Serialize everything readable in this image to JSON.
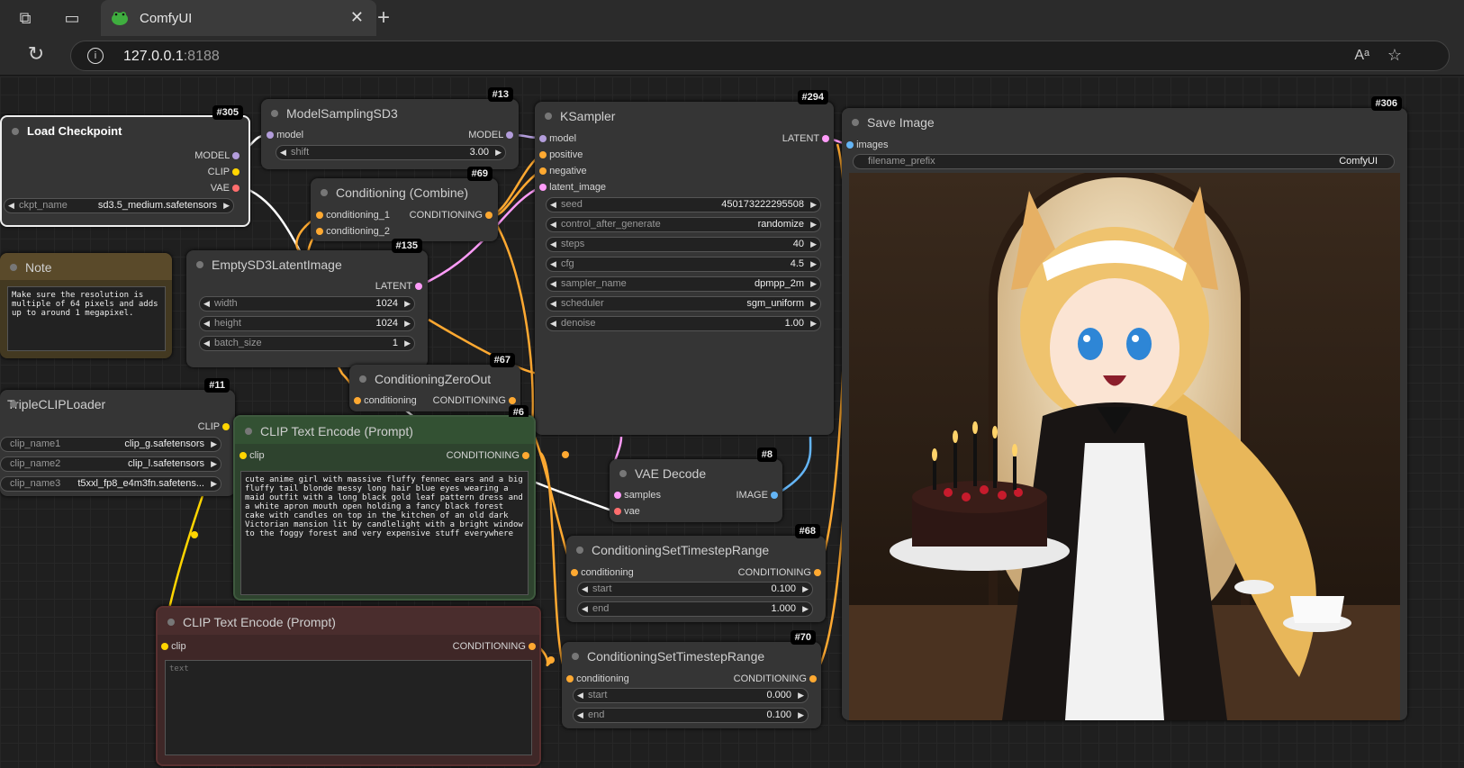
{
  "browser": {
    "tab_title": "ComfyUI",
    "url_host": "127.0.0.1",
    "url_port": ":8188"
  },
  "nodes": {
    "load_checkpoint": {
      "id": "#305",
      "title": "Load Checkpoint",
      "outputs": [
        "MODEL",
        "CLIP",
        "VAE"
      ],
      "widget": {
        "label": "ckpt_name",
        "value": "sd3.5_medium.safetensors"
      }
    },
    "model_sampling": {
      "id": "#13",
      "title": "ModelSamplingSD3",
      "input": "model",
      "output": "MODEL",
      "widget": {
        "label": "shift",
        "value": "3.00"
      }
    },
    "cond_combine": {
      "id": "#69",
      "title": "Conditioning (Combine)",
      "inputs": [
        "conditioning_1",
        "conditioning_2"
      ],
      "output": "CONDITIONING"
    },
    "note": {
      "title": "Note",
      "text": "Make sure the resolution is multiple of 64 pixels and adds up to around 1 megapixel."
    },
    "empty_latent": {
      "id": "#135",
      "title": "EmptySD3LatentImage",
      "output": "LATENT",
      "widgets": [
        {
          "label": "width",
          "value": "1024"
        },
        {
          "label": "height",
          "value": "1024"
        },
        {
          "label": "batch_size",
          "value": "1"
        }
      ]
    },
    "ksampler": {
      "id": "#294",
      "title": "KSampler",
      "inputs": [
        "model",
        "positive",
        "negative",
        "latent_image"
      ],
      "output": "LATENT",
      "widgets": [
        {
          "label": "seed",
          "value": "450173222295508"
        },
        {
          "label": "control_after_generate",
          "value": "randomize"
        },
        {
          "label": "steps",
          "value": "40"
        },
        {
          "label": "cfg",
          "value": "4.5"
        },
        {
          "label": "sampler_name",
          "value": "dpmpp_2m"
        },
        {
          "label": "scheduler",
          "value": "sgm_uniform"
        },
        {
          "label": "denoise",
          "value": "1.00"
        }
      ]
    },
    "cond_zero": {
      "id": "#67",
      "title": "ConditioningZeroOut",
      "input": "conditioning",
      "output": "CONDITIONING"
    },
    "triple_clip": {
      "id": "#11",
      "title": "TripleCLIPLoader",
      "output": "CLIP",
      "widgets": [
        {
          "label": "clip_name1",
          "value": "clip_g.safetensors"
        },
        {
          "label": "clip_name2",
          "value": "clip_l.safetensors"
        },
        {
          "label": "clip_name3",
          "value": "t5xxl_fp8_e4m3fn.safetens..."
        }
      ]
    },
    "clip_pos": {
      "id": "#6",
      "title": "CLIP Text Encode (Prompt)",
      "input": "clip",
      "output": "CONDITIONING",
      "text": "cute anime girl with massive fluffy fennec ears and a big fluffy tail blonde messy long hair blue eyes wearing a maid outfit with a long black gold leaf pattern dress and a white apron mouth open holding a fancy black forest cake with candles on top in the kitchen of an old dark Victorian mansion lit by candlelight with a bright window to the foggy forest and very expensive stuff everywhere"
    },
    "clip_neg": {
      "title": "CLIP Text Encode (Prompt)",
      "input": "clip",
      "output": "CONDITIONING",
      "placeholder": "text"
    },
    "vae_decode": {
      "id": "#8",
      "title": "VAE Decode",
      "inputs": [
        "samples",
        "vae"
      ],
      "output": "IMAGE"
    },
    "ts_range_a": {
      "id": "#68",
      "title": "ConditioningSetTimestepRange",
      "input": "conditioning",
      "output": "CONDITIONING",
      "widgets": [
        {
          "label": "start",
          "value": "0.100"
        },
        {
          "label": "end",
          "value": "1.000"
        }
      ]
    },
    "ts_range_b": {
      "id": "#70",
      "title": "ConditioningSetTimestepRange",
      "input": "conditioning",
      "output": "CONDITIONING",
      "widgets": [
        {
          "label": "start",
          "value": "0.000"
        },
        {
          "label": "end",
          "value": "0.100"
        }
      ]
    },
    "save_image": {
      "id": "#306",
      "title": "Save Image",
      "input": "images",
      "widget": {
        "label": "filename_prefix",
        "value": "ComfyUI"
      }
    }
  },
  "colors": {
    "model": "#b39ddb",
    "clip": "#ffd500",
    "vae": "#ff6e6e",
    "conditioning": "#ffa931",
    "latent": "#ff9cf9",
    "image": "#64b5f6"
  }
}
